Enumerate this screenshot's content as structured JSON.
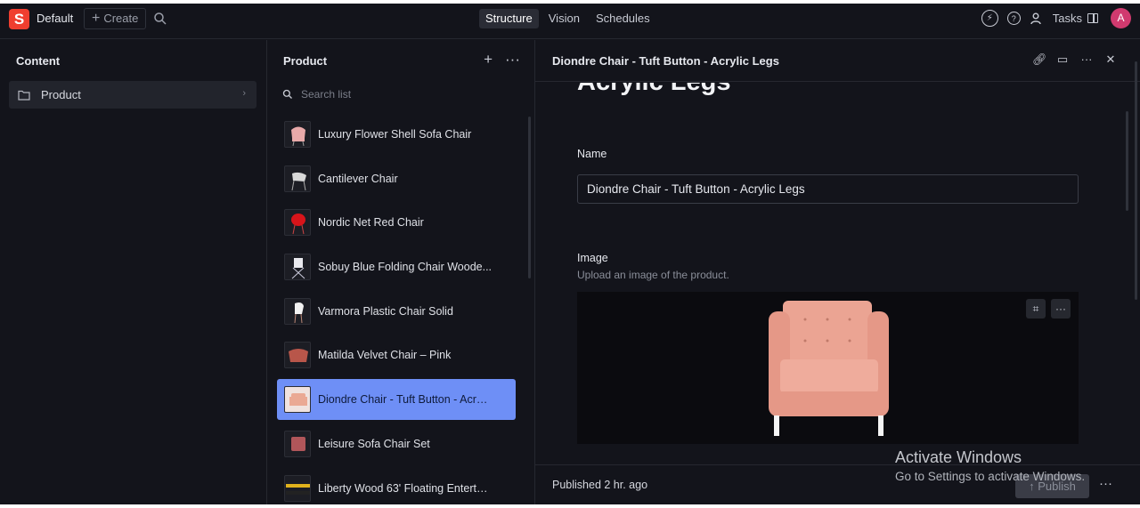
{
  "topbar": {
    "logo": "S",
    "workspace": "Default",
    "create_label": "Create",
    "nav_tabs": [
      {
        "label": "Structure",
        "active": true
      },
      {
        "label": "Vision",
        "active": false
      },
      {
        "label": "Schedules",
        "active": false
      }
    ],
    "tasks_label": "Tasks",
    "avatar_initial": "A"
  },
  "content_pane": {
    "title": "Content",
    "items": [
      {
        "label": "Product"
      }
    ]
  },
  "product_pane": {
    "title": "Product",
    "search_placeholder": "Search list",
    "items": [
      {
        "name": "Luxury Flower Shell Sofa Chair",
        "thumb_color": "#e8a9a9"
      },
      {
        "name": "Cantilever Chair",
        "thumb_color": "#d9d9d9"
      },
      {
        "name": "Nordic Net Red Chair",
        "thumb_color": "#d8141a"
      },
      {
        "name": "Sobuy Blue Folding Chair Woode...",
        "thumb_color": "#e9e9ee"
      },
      {
        "name": "Varmora Plastic Chair Solid",
        "thumb_color": "#f2f2f2"
      },
      {
        "name": "Matilda Velvet Chair – Pink",
        "thumb_color": "#b8564a"
      },
      {
        "name": "Diondre Chair - Tuft Button - Acryli...",
        "thumb_color": "#eaa994",
        "active": true
      },
      {
        "name": "Leisure Sofa Chair Set",
        "thumb_color": "#b0565a"
      },
      {
        "name": "Liberty Wood 63' Floating Entertai...",
        "thumb_color": "#e1b21c"
      }
    ]
  },
  "document": {
    "header_title": "Diondre Chair - Tuft Button - Acrylic Legs",
    "big_title": "Acrylic Legs",
    "name_label": "Name",
    "name_value": "Diondre Chair - Tuft Button - Acrylic Legs",
    "image_label": "Image",
    "image_description": "Upload an image of the product.",
    "status": "Published 2 hr. ago",
    "publish_label": "Publish"
  },
  "watermark": {
    "line1": "Activate Windows",
    "line2": "Go to Settings to activate Windows."
  }
}
